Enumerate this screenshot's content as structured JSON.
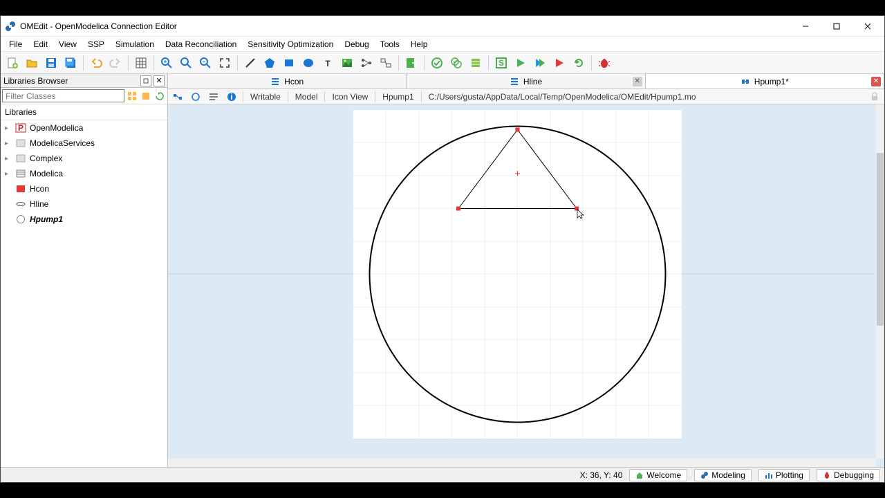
{
  "window": {
    "title": "OMEdit - OpenModelica Connection Editor"
  },
  "menus": [
    "File",
    "Edit",
    "View",
    "SSP",
    "Simulation",
    "Data Reconciliation",
    "Sensitivity Optimization",
    "Debug",
    "Tools",
    "Help"
  ],
  "sidebar": {
    "title": "Libraries Browser",
    "filter_placeholder": "Filter Classes",
    "section": "Libraries",
    "items": [
      {
        "label": "OpenModelica",
        "icon": "P",
        "color": "#c62828",
        "exp": true
      },
      {
        "label": "ModelicaServices",
        "icon": "box",
        "color": "#bdbdbd",
        "exp": true
      },
      {
        "label": "Complex",
        "icon": "box",
        "color": "#bdbdbd",
        "exp": true
      },
      {
        "label": "Modelica",
        "icon": "hatch",
        "color": "#9e9e9e",
        "exp": true
      },
      {
        "label": "Hcon",
        "icon": "solid",
        "color": "#e53935",
        "exp": false
      },
      {
        "label": "Hline",
        "icon": "pipe",
        "color": "#888",
        "exp": false
      },
      {
        "label": "Hpump1",
        "icon": "circle",
        "color": "#888",
        "exp": false,
        "bold": true
      }
    ]
  },
  "tabs": [
    {
      "label": "Hcon",
      "icon": "blue-lines",
      "active": false,
      "close": "none"
    },
    {
      "label": "Hline",
      "icon": "blue-lines",
      "active": false,
      "close": "grey"
    },
    {
      "label": "Hpump1*",
      "icon": "component",
      "active": true,
      "close": "red"
    }
  ],
  "docinfo": {
    "writable": "Writable",
    "kind": "Model",
    "view": "Icon View",
    "name": "Hpump1",
    "path": "C:/Users/gusta/AppData/Local/Temp/OpenModelica/OMEdit/Hpump1.mo"
  },
  "status": {
    "coords": "X: 36, Y: 40",
    "persp": [
      "Welcome",
      "Modeling",
      "Plotting",
      "Debugging"
    ]
  },
  "chart_data": {
    "type": "diagram",
    "canvas": {
      "xlim": [
        -100,
        100
      ],
      "ylim": [
        -100,
        100
      ]
    },
    "shapes": [
      {
        "kind": "ellipse",
        "cx": 0,
        "cy": 0,
        "rx": 90,
        "ry": 90,
        "stroke": "#000",
        "fill": "none"
      },
      {
        "kind": "polygon",
        "points": [
          [
            -36,
            40
          ],
          [
            0,
            88
          ],
          [
            36,
            40
          ]
        ],
        "stroke": "#000",
        "fill": "none",
        "selected": true
      }
    ],
    "cursor": {
      "x": 36,
      "y": 40
    }
  }
}
